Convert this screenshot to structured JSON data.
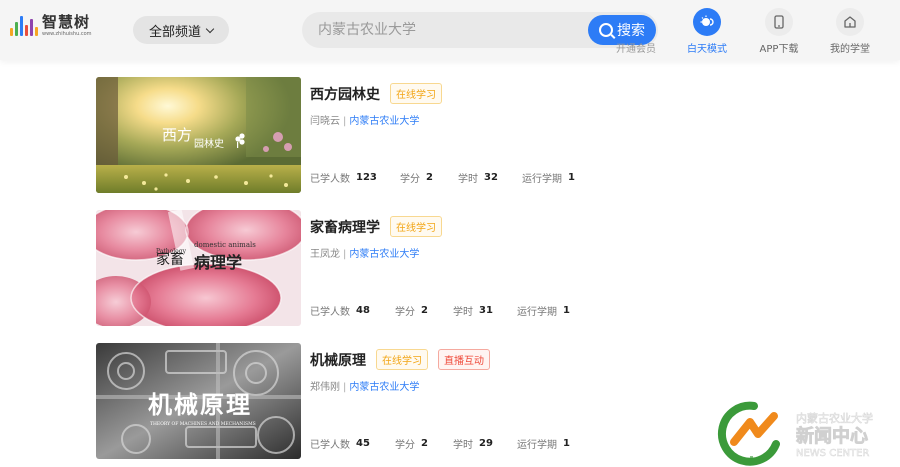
{
  "header": {
    "logo_name": "智慧树",
    "logo_domain": "www.zhihuishu.com",
    "channel_label": "全部频道",
    "search_placeholder": "内蒙古农业大学",
    "search_button": "搜索",
    "nav": [
      {
        "label": "开通会员",
        "icon": "vip-icon"
      },
      {
        "label": "白天模式",
        "icon": "sun-icon"
      },
      {
        "label": "APP下载",
        "icon": "phone-icon"
      },
      {
        "label": "我的学堂",
        "icon": "home-icon"
      }
    ]
  },
  "courses": [
    {
      "title": "西方园林史",
      "tags": [
        "在线学习"
      ],
      "teacher": "闫晓云",
      "separator": "|",
      "school": "内蒙古农业大学",
      "cover_text": [
        "西方",
        "园林史"
      ],
      "stats": [
        {
          "label": "已学人数",
          "value": "123"
        },
        {
          "label": "学分",
          "value": "2"
        },
        {
          "label": "学时",
          "value": "32"
        },
        {
          "label": "运行学期",
          "value": "1"
        }
      ]
    },
    {
      "title": "家畜病理学",
      "tags": [
        "在线学习"
      ],
      "teacher": "王凤龙",
      "separator": "|",
      "school": "内蒙古农业大学",
      "cover_text": [
        "家畜",
        "病理学",
        "domestic animals",
        "Pathology"
      ],
      "stats": [
        {
          "label": "已学人数",
          "value": "48"
        },
        {
          "label": "学分",
          "value": "2"
        },
        {
          "label": "学时",
          "value": "31"
        },
        {
          "label": "运行学期",
          "value": "1"
        }
      ]
    },
    {
      "title": "机械原理",
      "tags": [
        "在线学习",
        "直播互动"
      ],
      "teacher": "郑伟刚",
      "separator": "|",
      "school": "内蒙古农业大学",
      "cover_text": [
        "机械原理",
        "THEORY OF MACHINES AND MECHANISMS"
      ],
      "stats": [
        {
          "label": "已学人数",
          "value": "45"
        },
        {
          "label": "学分",
          "value": "2"
        },
        {
          "label": "学时",
          "value": "29"
        },
        {
          "label": "运行学期",
          "value": "1"
        }
      ]
    }
  ],
  "watermark": {
    "line1": "内蒙古农业大学",
    "line2": "新闻中心",
    "line3": "NEWS CENTER"
  },
  "colors": {
    "accent": "#2d7cf6",
    "tag_online": "#f2a515",
    "tag_live": "#ef4b3c"
  }
}
